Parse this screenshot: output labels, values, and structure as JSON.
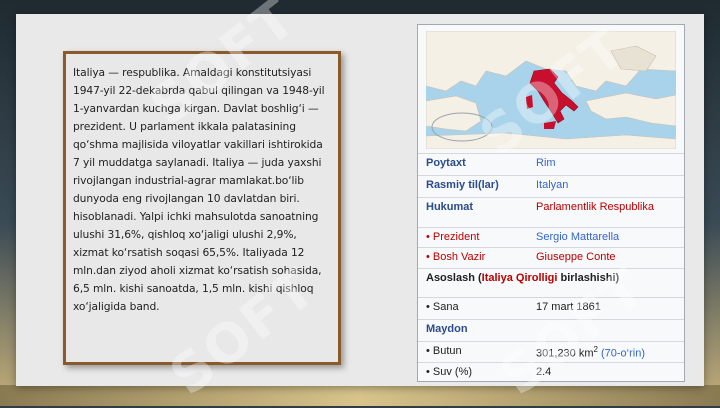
{
  "paragraph": "Italiya — respublika. Amaldagi konstitutsiyasi 1947-yil 22-dekabrda qabul qilingan va 1948-yil 1-yanvardan kuchga kirgan. Davlat boshlig‘i — prezident. U parlament ikkala palatasining qo‘shma majlisida viloyatlar vakillari ishtirokida 7 yil muddatga saylanadi. Italiya — juda yaxshi rivojlangan industrial-agrar mamlakat.bo‘lib dunyoda eng rivojlangan 10 davlatdan biri. hisoblanadi. Yalpi ichki mahsulotda sanoatning ulushi 31,6%, qishloq xo‘jaligi ulushi 2,9%, xizmat ko‘rsatish soqasi 65,5%. Italiyada 12 mln.dan ziyod aholi xizmat ko‘rsatish sohasida, 6,5 mln. kishi sanoatda, 1,5 mln. kishi qishloq xo‘jaligida band.",
  "infobox": {
    "poytaxt_label": "Poytaxt",
    "poytaxt_value": "Rim",
    "til_label": "Rasmiy til(lar)",
    "til_value": "Italyan",
    "hukumat_label": "Hukumat",
    "hukumat_value": "Parlamentlik Respublika",
    "prezident_label": "• Prezident",
    "prezident_value": "Sergio Mattarella",
    "vazir_label": "• Bosh Vazir",
    "vazir_value": "Giuseppe Conte",
    "asoslash_pre": "Asoslash (",
    "asoslash_link": "Italiya Qirolligi",
    "asoslash_post": " birlashishi)",
    "sana_label": "• Sana",
    "sana_value": "17 mart 1861",
    "maydon_label": "Maydon",
    "butun_label": "• Butun",
    "butun_value": "301,230 km",
    "butun_sup": "2",
    "butun_rank": " (70-o‘rin)",
    "suv_label": "• Suv (%)",
    "suv_value": "2.4"
  },
  "watermark": "SOFT",
  "colors": {
    "frame": "#8b5a2b",
    "link": "#3366cc",
    "red_link": "#ba0000",
    "italy": "#c8102e"
  }
}
